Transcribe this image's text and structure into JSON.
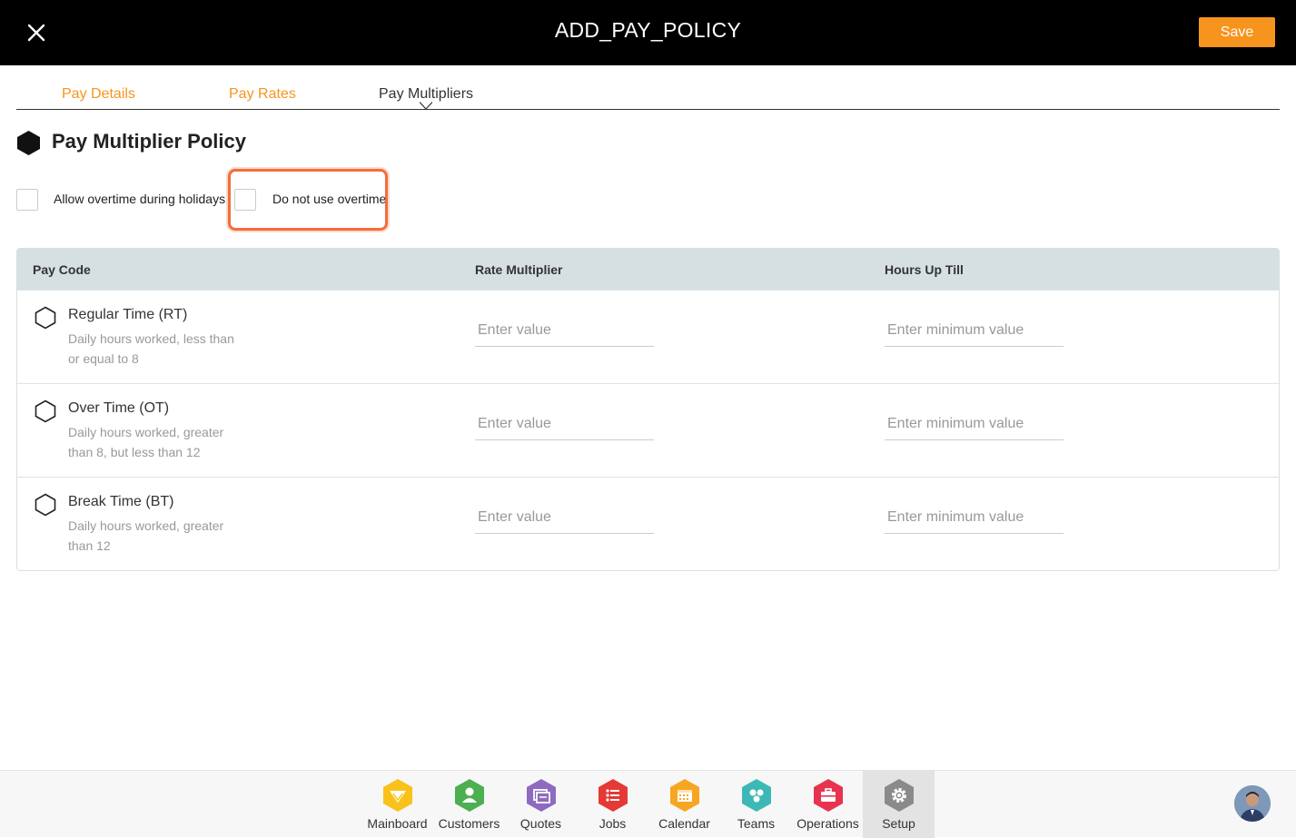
{
  "header": {
    "title": "ADD_PAY_POLICY",
    "save_label": "Save",
    "close_icon": "close-icon"
  },
  "tabs": [
    {
      "label": "Pay Details",
      "state": "inactive"
    },
    {
      "label": "Pay Rates",
      "state": "inactive"
    },
    {
      "label": "Pay Multipliers",
      "state": "active"
    }
  ],
  "section": {
    "title": "Pay Multiplier Policy",
    "icon": "hexagon-filled-icon"
  },
  "options": {
    "allow_overtime_holidays": {
      "label": "Allow overtime during holidays",
      "checked": false
    },
    "do_not_use_overtime": {
      "label": "Do not use overtime",
      "checked": false,
      "highlighted": true
    }
  },
  "table": {
    "headers": [
      "Pay Code",
      "Rate Multiplier",
      "Hours Up Till"
    ],
    "rows": [
      {
        "title": "Regular Time (RT)",
        "desc": "Daily hours worked, less than or equal to 8",
        "rate_placeholder": "Enter value",
        "hours_placeholder": "Enter minimum value"
      },
      {
        "title": "Over Time (OT)",
        "desc": "Daily hours worked, greater than 8, but less than 12",
        "rate_placeholder": "Enter value",
        "hours_placeholder": "Enter minimum value"
      },
      {
        "title": "Break Time (BT)",
        "desc": "Daily hours worked, greater than 12",
        "rate_placeholder": "Enter value",
        "hours_placeholder": "Enter minimum value"
      }
    ]
  },
  "bottom_nav": {
    "items": [
      {
        "label": "Mainboard",
        "icon": "mainboard-icon",
        "color": "#f9c21b"
      },
      {
        "label": "Customers",
        "icon": "customers-icon",
        "color": "#4caf50"
      },
      {
        "label": "Quotes",
        "icon": "quotes-icon",
        "color": "#8e6bbf"
      },
      {
        "label": "Jobs",
        "icon": "jobs-icon",
        "color": "#e53935"
      },
      {
        "label": "Calendar",
        "icon": "calendar-icon",
        "color": "#f6a623"
      },
      {
        "label": "Teams",
        "icon": "teams-icon",
        "color": "#3cb9b6"
      },
      {
        "label": "Operations",
        "icon": "operations-icon",
        "color": "#e8334f"
      },
      {
        "label": "Setup",
        "icon": "setup-icon",
        "color": "#8a8a8a",
        "active": true
      }
    ],
    "avatar": "user-avatar"
  },
  "colors": {
    "accent": "#f7941d",
    "header_bg": "#000000",
    "table_header_bg": "#d6e0e3",
    "highlight": "#f26d3d"
  }
}
